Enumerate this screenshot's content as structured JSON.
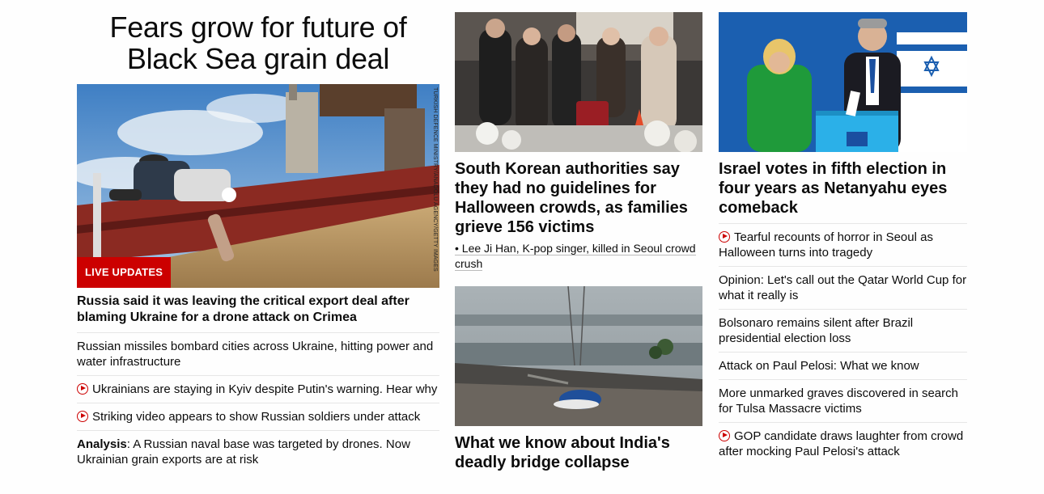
{
  "left": {
    "hero_title": "Fears grow for future of Black Sea grain deal",
    "image_credit": "TURKISH DEFENCE MINISTRY/ANADOLU AGENCY/GETTY IMAGES",
    "live_badge": "LIVE UPDATES",
    "headline": "Russia said it was leaving the critical export deal after blaming Ukraine for a drone attack on Crimea",
    "items": [
      {
        "text": "Russian missiles bombard cities across Ukraine, hitting power and water infrastructure",
        "video": false
      },
      {
        "text": "Ukrainians are staying in Kyiv despite Putin's warning. Hear why",
        "video": true
      },
      {
        "text": "Striking video appears to show Russian soldiers under attack",
        "video": true
      }
    ],
    "analysis_label": "Analysis",
    "analysis_text": ": A Russian naval base was targeted by drones. Now Ukrainian grain exports are at risk"
  },
  "middle": {
    "story1_headline": "South Korean authorities say they had no guidelines for Halloween crowds, as families grieve 156 victims",
    "story1_sub": "• Lee Ji Han, K-pop singer, killed in Seoul crowd crush",
    "story2_headline": "What we know about India's deadly bridge collapse"
  },
  "right": {
    "headline": "Israel votes in fifth election in four years as Netanyahu eyes comeback",
    "items": [
      {
        "text": "Tearful recounts of horror in Seoul as Halloween turns into tragedy",
        "video": true
      },
      {
        "text": "Opinion: Let's call out the Qatar World Cup for what it really is",
        "video": false
      },
      {
        "text": "Bolsonaro remains silent after Brazil presidential election loss",
        "video": false
      },
      {
        "text": "Attack on Paul Pelosi: What we know",
        "video": false
      },
      {
        "text": "More unmarked graves discovered in search for Tulsa Massacre victims",
        "video": false
      },
      {
        "text": "GOP candidate draws laughter from crowd after mocking Paul Pelosi's attack",
        "video": true
      }
    ]
  },
  "colors": {
    "accent": "#cc0000",
    "text": "#0c0c0c",
    "divider": "#e6e6e6"
  },
  "icons": {
    "video": "play-circle-icon"
  }
}
